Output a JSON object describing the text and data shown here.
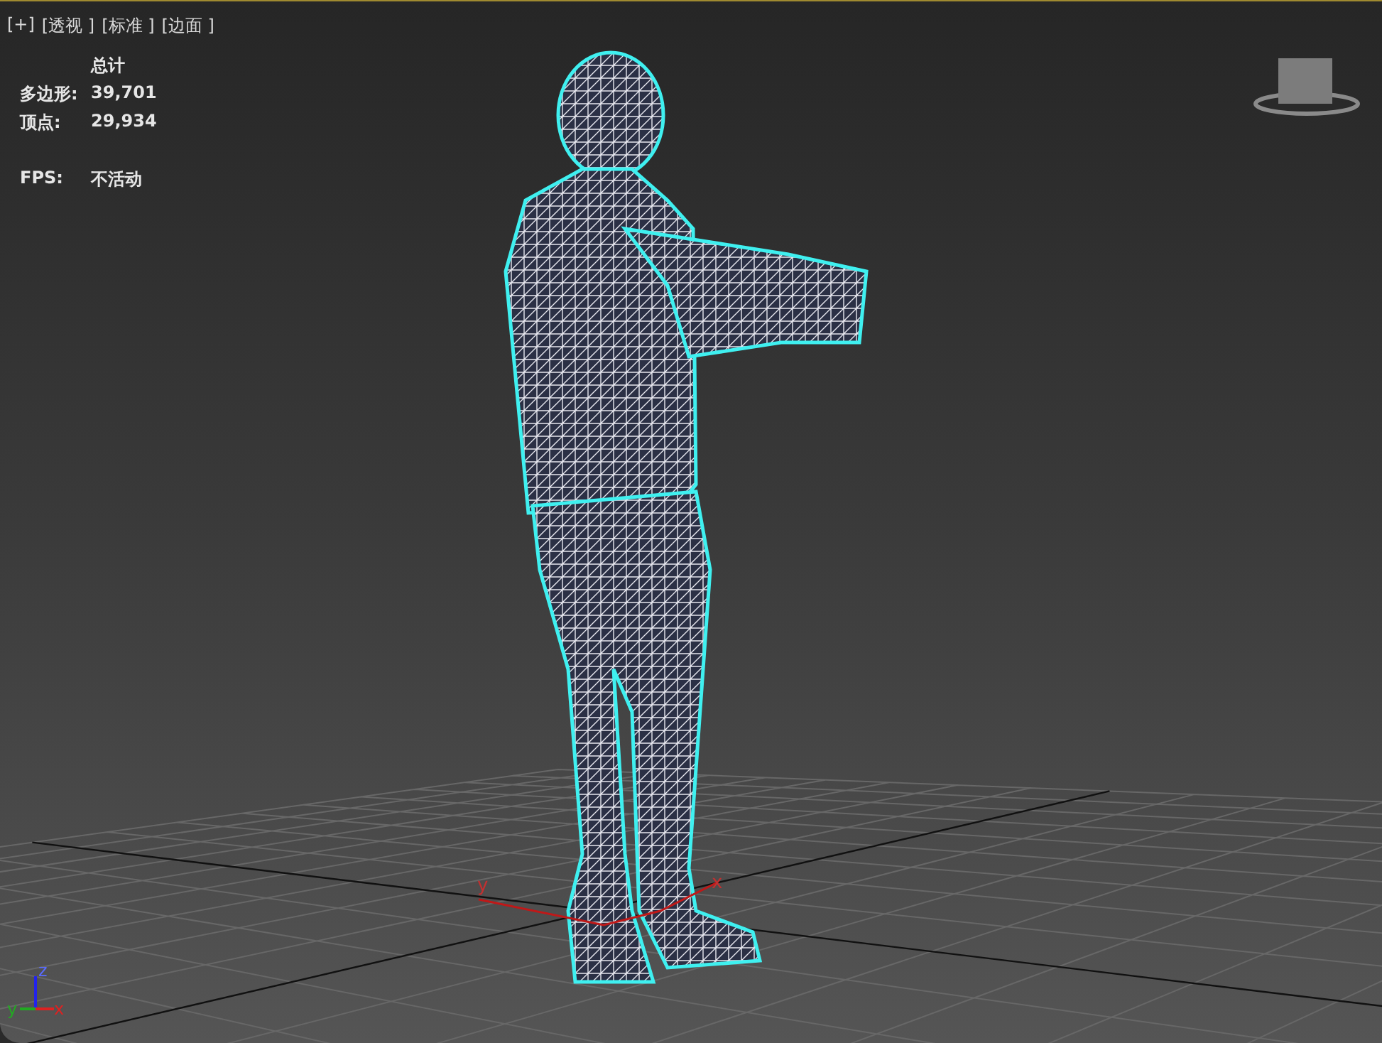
{
  "viewport_labels": [
    "[+]",
    "[透视 ]",
    "[标准 ]",
    "[边面 ]"
  ],
  "stats": {
    "header": "总计",
    "rows": [
      {
        "label": "多边形:",
        "value": "39,701"
      },
      {
        "label": "顶点:",
        "value": "29,934"
      }
    ],
    "fps": {
      "label": "FPS:",
      "value": "不活动"
    }
  },
  "gizmo": {
    "x_label": "x",
    "y_label": "y"
  },
  "axis_tripod": {
    "x_label": "x",
    "y_label": "y",
    "z_label": "z"
  }
}
